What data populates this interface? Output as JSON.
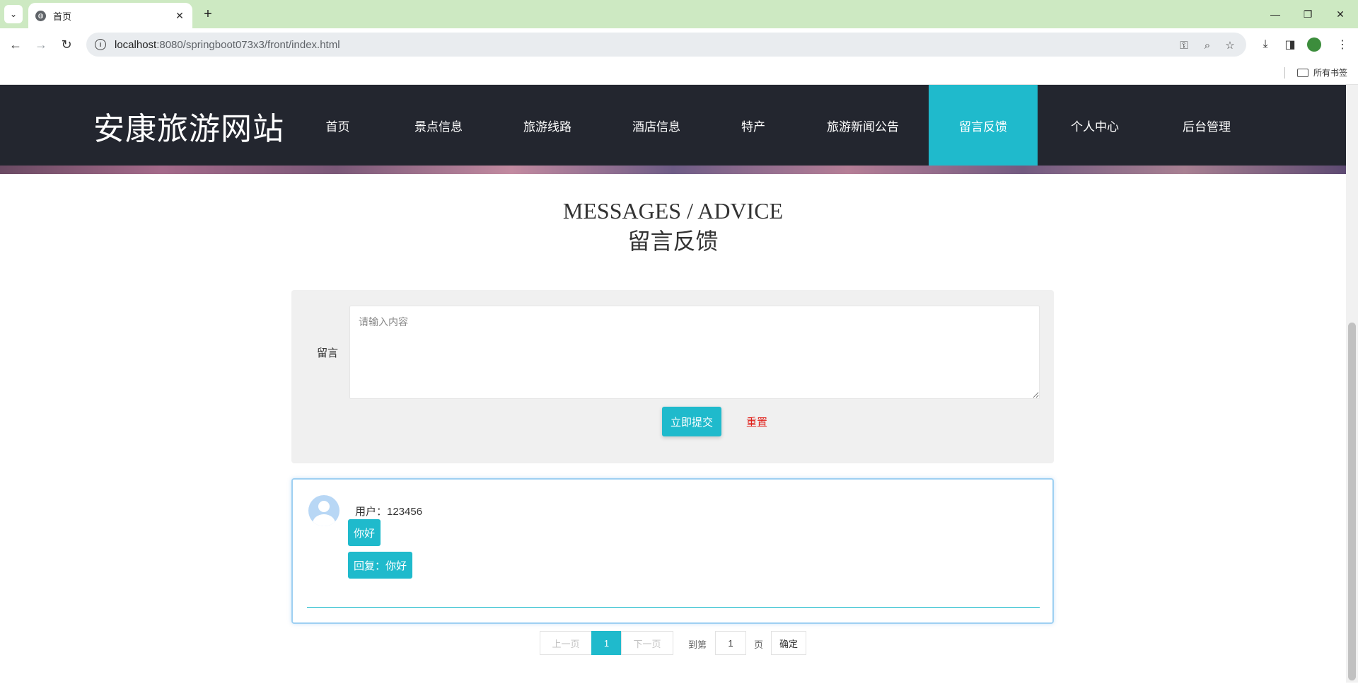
{
  "browser": {
    "tab_title": "首页",
    "url_host": "localhost",
    "url_rest": ":8080/springboot073x3/front/index.html",
    "bookmarks_label": "所有书签"
  },
  "site": {
    "logo": "安康旅游网站",
    "menu": [
      {
        "label": "首页",
        "active": false
      },
      {
        "label": "景点信息",
        "active": false
      },
      {
        "label": "旅游线路",
        "active": false
      },
      {
        "label": "酒店信息",
        "active": false
      },
      {
        "label": "特产",
        "active": false
      },
      {
        "label": "旅游新闻公告",
        "active": false
      },
      {
        "label": "留言反馈",
        "active": true
      },
      {
        "label": "个人中心",
        "active": false
      },
      {
        "label": "后台管理",
        "active": false
      }
    ],
    "accent_color": "#1fbacc",
    "header_bg": "#23262f"
  },
  "page": {
    "heading_en": "MESSAGES / ADVICE",
    "heading_zh": "留言反馈"
  },
  "form": {
    "label": "留言",
    "placeholder": "请输入内容",
    "value": "",
    "submit_label": "立即提交",
    "reset_label": "重置"
  },
  "messages": [
    {
      "user_line": "用户：123456",
      "content": "你好",
      "reply": "回复：你好"
    }
  ],
  "pager": {
    "prev_label": "上一页",
    "current_page": "1",
    "next_label": "下一页",
    "goto_label": "到第",
    "goto_value": "1",
    "page_suffix": "页",
    "confirm_label": "确定"
  }
}
